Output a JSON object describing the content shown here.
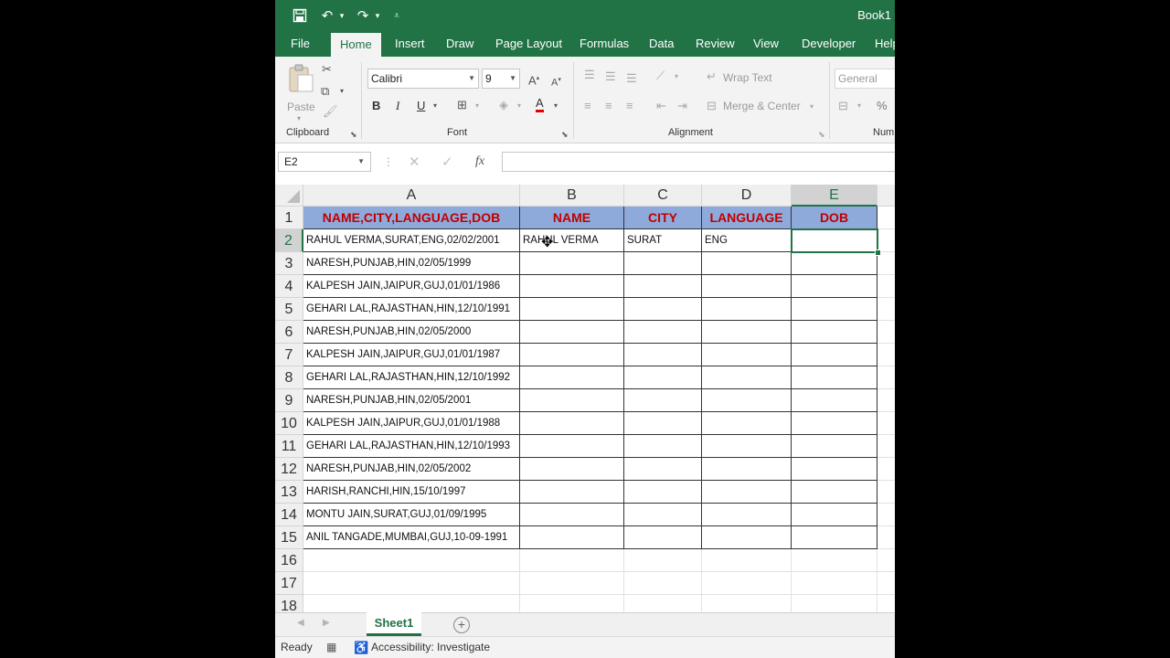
{
  "window": {
    "title": "Book1"
  },
  "quick_access": {
    "save_icon": "save-icon",
    "undo_icon": "undo-icon",
    "redo_icon": "redo-icon",
    "customize_icon": "customize-icon"
  },
  "tabs": [
    "File",
    "Home",
    "Insert",
    "Draw",
    "Page Layout",
    "Formulas",
    "Data",
    "Review",
    "View",
    "Developer",
    "Help"
  ],
  "ribbon": {
    "clipboard": {
      "paste_label": "Paste",
      "group_label": "Clipboard"
    },
    "font": {
      "font_name": "Calibri",
      "font_size": "9",
      "bold": "B",
      "italic": "I",
      "underline": "U",
      "group_label": "Font"
    },
    "alignment": {
      "wrap_text": "Wrap Text",
      "merge_center": "Merge & Center",
      "group_label": "Alignment"
    },
    "number": {
      "format": "General",
      "percent": "%",
      "group_label": "Num"
    }
  },
  "formula_bar": {
    "name_box": "E2",
    "fx_label": "fx",
    "value": ""
  },
  "columns": [
    "A",
    "B",
    "C",
    "D",
    "E"
  ],
  "selected": {
    "column": "E",
    "row": "2"
  },
  "header_row": [
    "NAME,CITY,LANGUAGE,DOB",
    "NAME",
    "CITY",
    "LANGUAGE",
    "DOB"
  ],
  "rows": [
    {
      "num": "2",
      "a": "RAHUL VERMA,SURAT,ENG,02/02/2001",
      "b": "RAHUL VERMA",
      "c": "SURAT",
      "d": "ENG",
      "e": ""
    },
    {
      "num": "3",
      "a": "NARESH,PUNJAB,HIN,02/05/1999",
      "b": "",
      "c": "",
      "d": "",
      "e": ""
    },
    {
      "num": "4",
      "a": "KALPESH JAIN,JAIPUR,GUJ,01/01/1986",
      "b": "",
      "c": "",
      "d": "",
      "e": ""
    },
    {
      "num": "5",
      "a": "GEHARI LAL,RAJASTHAN,HIN,12/10/1991",
      "b": "",
      "c": "",
      "d": "",
      "e": ""
    },
    {
      "num": "6",
      "a": "NARESH,PUNJAB,HIN,02/05/2000",
      "b": "",
      "c": "",
      "d": "",
      "e": ""
    },
    {
      "num": "7",
      "a": "KALPESH JAIN,JAIPUR,GUJ,01/01/1987",
      "b": "",
      "c": "",
      "d": "",
      "e": ""
    },
    {
      "num": "8",
      "a": "GEHARI LAL,RAJASTHAN,HIN,12/10/1992",
      "b": "",
      "c": "",
      "d": "",
      "e": ""
    },
    {
      "num": "9",
      "a": "NARESH,PUNJAB,HIN,02/05/2001",
      "b": "",
      "c": "",
      "d": "",
      "e": ""
    },
    {
      "num": "10",
      "a": "KALPESH JAIN,JAIPUR,GUJ,01/01/1988",
      "b": "",
      "c": "",
      "d": "",
      "e": ""
    },
    {
      "num": "11",
      "a": "GEHARI LAL,RAJASTHAN,HIN,12/10/1993",
      "b": "",
      "c": "",
      "d": "",
      "e": ""
    },
    {
      "num": "12",
      "a": "NARESH,PUNJAB,HIN,02/05/2002",
      "b": "",
      "c": "",
      "d": "",
      "e": ""
    },
    {
      "num": "13",
      "a": "HARISH,RANCHI,HIN,15/10/1997",
      "b": "",
      "c": "",
      "d": "",
      "e": ""
    },
    {
      "num": "14",
      "a": "MONTU JAIN,SURAT,GUJ,01/09/1995",
      "b": "",
      "c": "",
      "d": "",
      "e": ""
    },
    {
      "num": "15",
      "a": "ANIL TANGADE,MUMBAI,GUJ,10-09-1991",
      "b": "",
      "c": "",
      "d": "",
      "e": ""
    }
  ],
  "empty_rows": [
    "16",
    "17",
    "18"
  ],
  "sheet_tabs": [
    "Sheet1"
  ],
  "status": {
    "ready": "Ready",
    "accessibility": "Accessibility: Investigate"
  },
  "colors": {
    "excel_green": "#217346",
    "header_fill": "#8eaadb",
    "header_text": "#c00000"
  }
}
